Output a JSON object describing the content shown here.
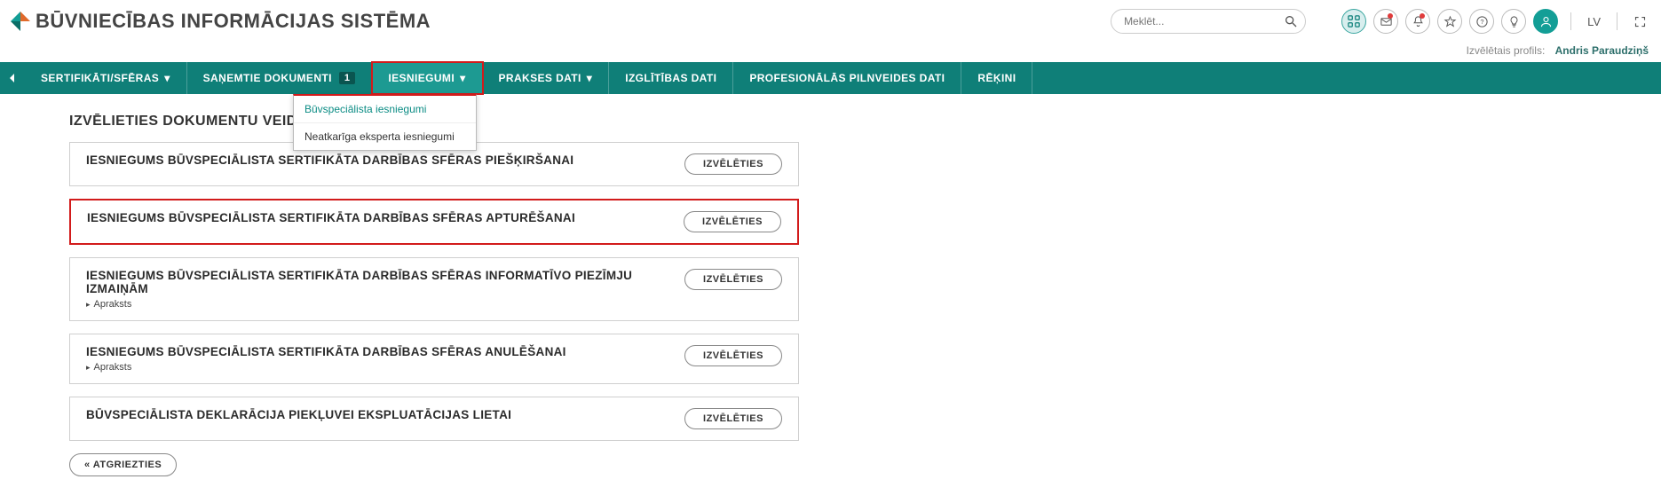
{
  "header": {
    "app_title": "Būvniecības informācijas sistēma",
    "search_placeholder": "Meklēt...",
    "lang": "LV",
    "profile_label": "Izvēlētais profils:",
    "profile_name": "Andris Paraudziņš"
  },
  "nav": {
    "items": [
      {
        "label": "SERTIFIKĀTI/SFĒRAS",
        "caret": true
      },
      {
        "label": "SAŅEMTIE DOKUMENTI",
        "badge": "1"
      },
      {
        "label": "IESNIEGUMI",
        "caret": true,
        "active": true,
        "highlight": true
      },
      {
        "label": "PRAKSES DATI",
        "caret": true
      },
      {
        "label": "IZGLĪTĪBAS DATI"
      },
      {
        "label": "PROFESIONĀLĀS PILNVEIDES DATI"
      },
      {
        "label": "RĒĶINI"
      }
    ],
    "dropdown": {
      "items": [
        {
          "label": "Būvspeciālista iesniegumi",
          "selected": true
        },
        {
          "label": "Neatkarīga eksperta iesniegumi"
        }
      ]
    }
  },
  "content": {
    "section_title": "Izvēlieties dokumentu veidu:",
    "select_label": "Izvēlēties",
    "back_label": "« Atgriezties",
    "desc_label": "Apraksts",
    "cards": [
      {
        "title": "Iesniegums būvspeciālista sertifikāta darbības sfēras piešķiršanai"
      },
      {
        "title": "Iesniegums būvspeciālista sertifikāta darbības sfēras apturēšanai",
        "highlight": true
      },
      {
        "title": "Iesniegums būvspeciālista sertifikāta darbības sfēras informatīvo piezīmju izmaiņām",
        "has_desc": true
      },
      {
        "title": "Iesniegums būvspeciālista sertifikāta darbības sfēras anulēšanai",
        "has_desc": true
      },
      {
        "title": "Būvspeciālista deklarācija piekļuvei ekspluatācijas lietai"
      }
    ]
  }
}
